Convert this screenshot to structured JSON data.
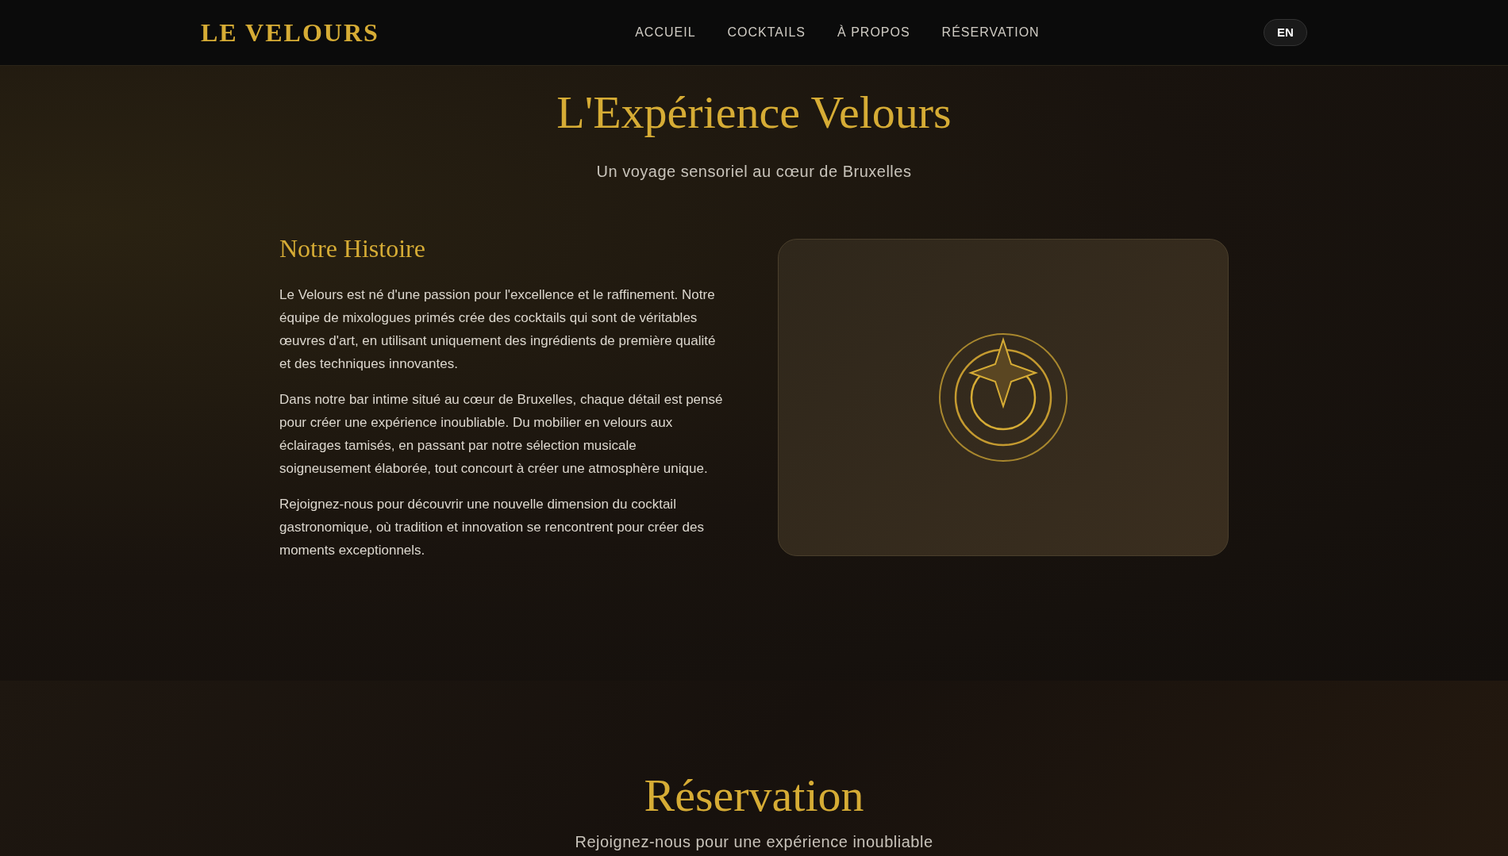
{
  "header": {
    "logo": "LE VELOURS",
    "nav": [
      {
        "label": "ACCUEIL"
      },
      {
        "label": "COCKTAILS"
      },
      {
        "label": "À PROPOS"
      },
      {
        "label": "RÉSERVATION"
      }
    ],
    "language_button": "EN"
  },
  "about": {
    "title": "L'Expérience Velours",
    "subtitle": "Un voyage sensoriel au cœur de Bruxelles",
    "story_title": "Notre Histoire",
    "paragraphs": [
      "Le Velours est né d'une passion pour l'excellence et le raffinement. Notre équipe de mixologues primés crée des cocktails qui sont de véritables œuvres d'art, en utilisant uniquement des ingrédients de première qualité et des techniques innovantes.",
      "Dans notre bar intime situé au cœur de Bruxelles, chaque détail est pensé pour créer une expérience inoubliable. Du mobilier en velours aux éclairages tamisés, en passant par notre sélection musicale soigneusement élaborée, tout concourt à créer une atmosphère unique.",
      "Rejoignez-nous pour découvrir une nouvelle dimension du cocktail gastronomique, où tradition et innovation se rencontrent pour créer des moments exceptionnels."
    ]
  },
  "reservation": {
    "title": "Réservation",
    "subtitle": "Rejoignez-nous pour une expérience inoubliable"
  }
}
